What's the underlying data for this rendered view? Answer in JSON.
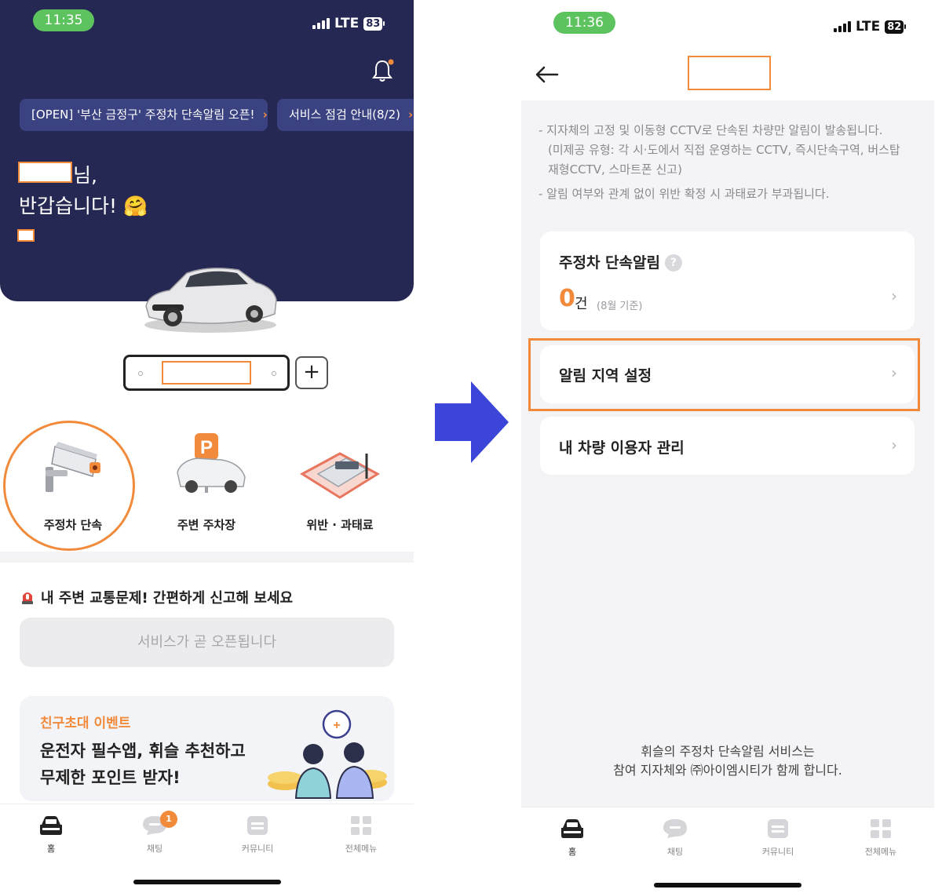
{
  "left": {
    "status": {
      "time": "11:35",
      "network": "LTE",
      "battery": "83"
    },
    "notices": [
      {
        "text": "[OPEN] '부산 금정구' 주정차 단속알림 오픈!"
      },
      {
        "text": "서비스 점검 안내(8/2)"
      }
    ],
    "greeting": {
      "suffix": "님,",
      "line2": "반갑습니다! 🤗"
    },
    "categories": [
      {
        "label": "주정차 단속",
        "icon": "cctv-icon"
      },
      {
        "label": "주변 주차장",
        "icon": "parking-car-icon"
      },
      {
        "label": "위반 · 과태료",
        "icon": "fine-money-icon"
      }
    ],
    "report": {
      "title": "내 주변 교통문제! 간편하게 신고해 보세요",
      "button": "서비스가 곧 오픈됩니다"
    },
    "event": {
      "tag": "친구초대 이벤트",
      "line1": "운전자 필수앱, 휘슬 추천하고",
      "line2": "무제한 포인트 받자!"
    },
    "tabs": [
      {
        "label": "홈",
        "icon": "car-front-icon"
      },
      {
        "label": "채팅",
        "icon": "chat-bubble-icon",
        "badge": "1"
      },
      {
        "label": "커뮤니티",
        "icon": "community-icon"
      },
      {
        "label": "전체메뉴",
        "icon": "grid-menu-icon"
      }
    ]
  },
  "right": {
    "status": {
      "time": "11:36",
      "network": "LTE",
      "battery": "82"
    },
    "info": [
      "- 지자체의 고정 및 이동형 CCTV로 단속된 차량만 알림이 발송됩니다.",
      "(미제공 유형: 각 시·도에서 직접 운영하는 CCTV, 즉시단속구역, 버스탑",
      "재형CCTV, 스마트폰 신고)",
      "- 알림 여부와 관계 없이 위반 확정 시 과태료가 부과됩니다."
    ],
    "alert_card": {
      "title": "주정차 단속알림",
      "count": "0",
      "unit": "건",
      "note": "(8월 기준)"
    },
    "menu": [
      {
        "label": "알림 지역 설정"
      },
      {
        "label": "내 차량 이용자 관리"
      }
    ],
    "footer": [
      "휘슬의 주정차 단속알림 서비스는",
      "참여 지자체와 ㈜아이엠시티가 함께 합니다."
    ],
    "tabs": [
      {
        "label": "홈",
        "icon": "car-front-icon"
      },
      {
        "label": "채팅",
        "icon": "chat-bubble-icon"
      },
      {
        "label": "커뮤니티",
        "icon": "community-icon"
      },
      {
        "label": "전체메뉴",
        "icon": "grid-menu-icon"
      }
    ]
  },
  "colors": {
    "navy": "#252852",
    "accent": "#f28a3c",
    "arrow": "#3b45d8",
    "status_green": "#5dc35e"
  }
}
